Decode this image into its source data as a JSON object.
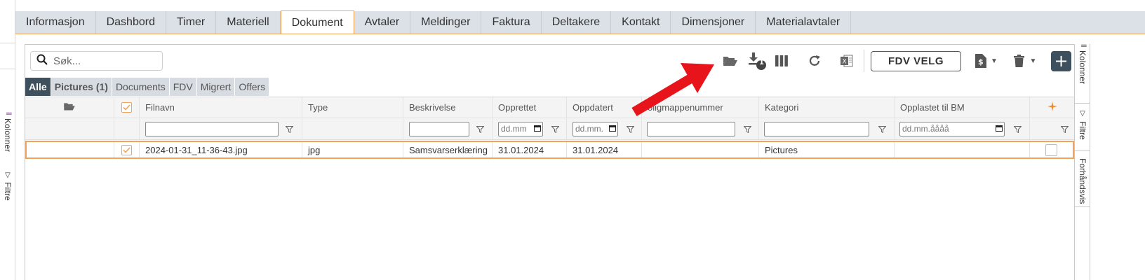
{
  "left_strip": {
    "kolonner": "Kolonner",
    "filtre": "Filtre"
  },
  "tabs": [
    {
      "label": "Informasjon",
      "active": false
    },
    {
      "label": "Dashbord",
      "active": false
    },
    {
      "label": "Timer",
      "active": false
    },
    {
      "label": "Materiell",
      "active": false
    },
    {
      "label": "Dokument",
      "active": true
    },
    {
      "label": "Avtaler",
      "active": false
    },
    {
      "label": "Meldinger",
      "active": false
    },
    {
      "label": "Faktura",
      "active": false
    },
    {
      "label": "Deltakere",
      "active": false
    },
    {
      "label": "Kontakt",
      "active": false
    },
    {
      "label": "Dimensjoner",
      "active": false
    },
    {
      "label": "Materialavtaler",
      "active": false
    }
  ],
  "search": {
    "placeholder": "Søk..."
  },
  "toolbar": {
    "icons": [
      "open-folder-icon",
      "download-icon",
      "columns-icon",
      "refresh-icon",
      "excel-icon"
    ],
    "download_badge": "1",
    "fdv_label": "FDV VELG",
    "plus_label": "+"
  },
  "chips": [
    {
      "label": "Alle",
      "active": true
    },
    {
      "label": "Pictures (1)",
      "active": false
    },
    {
      "label": "Documents",
      "active": false
    },
    {
      "label": "FDV",
      "active": false
    },
    {
      "label": "Migrert",
      "active": false
    },
    {
      "label": "Offers",
      "active": false
    }
  ],
  "columns": {
    "filnavn": "Filnavn",
    "type": "Type",
    "beskrivelse": "Beskrivelse",
    "opprettet": "Opprettet",
    "oppdatert": "Oppdatert",
    "boligmappe": "oligmappenummer",
    "kategori": "Kategori",
    "opplastet": "Opplastet til BM"
  },
  "filters": {
    "date_placeholder_short": "dd.mm",
    "date_placeholder_mid": "dd.mm.",
    "date_placeholder_full": "dd.mm.åååå"
  },
  "rows": [
    {
      "filnavn": "2024-01-31_11-36-43.jpg",
      "type": "jpg",
      "beskrivelse": "Samsvarserklæring",
      "opprettet": "31.01.2024",
      "oppdatert": "31.01.2024",
      "boligmappe": "",
      "kategori": "Pictures",
      "opplastet": ""
    }
  ],
  "right_panel": {
    "kolonner": "Kolonner",
    "filtre": "Filtre",
    "forhandsvis": "Forhåndsvis"
  },
  "colors": {
    "accent": "#f0a35a",
    "tab_bg": "#dbe1e6",
    "dark": "#3e4f5d",
    "arrow": "#e8141b"
  }
}
